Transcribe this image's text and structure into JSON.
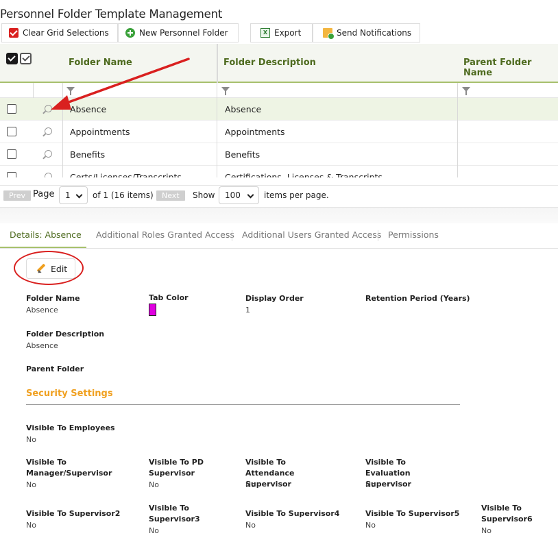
{
  "page": {
    "title": "Personnel Folder Template Management"
  },
  "toolbar": {
    "clear_label": "Clear Grid Selections",
    "new_label": "New Personnel Folder",
    "export_label": "Export",
    "notify_label": "Send Notifications",
    "export_icon_text": "X"
  },
  "grid": {
    "headers": [
      "Folder Name",
      "Folder Description",
      "Parent Folder Name"
    ],
    "rows": [
      {
        "name": "Absence",
        "description": "Absence",
        "parent": ""
      },
      {
        "name": "Appointments",
        "description": "Appointments",
        "parent": ""
      },
      {
        "name": "Benefits",
        "description": "Benefits",
        "parent": ""
      },
      {
        "name": "Certs/Licenses/Transcripts",
        "description": "Certifications, Licenses & Transcripts",
        "parent": ""
      }
    ]
  },
  "pager": {
    "prev": "Prev",
    "page_label": "Page",
    "page_value": "1",
    "of_text": "of 1 (16 items)",
    "next": "Next",
    "show_label": "Show",
    "per_page_value": "100",
    "per_page_suffix": "items per page."
  },
  "tabs": [
    {
      "label": "Details: Absence",
      "active": true
    },
    {
      "label": "Additional Roles Granted Access",
      "active": false
    },
    {
      "label": "Additional Users Granted Access",
      "active": false
    },
    {
      "label": "Permissions",
      "active": false
    }
  ],
  "details": {
    "edit_label": "Edit",
    "folder_name_label": "Folder Name",
    "folder_name_value": "Absence",
    "tab_color_label": "Tab Color",
    "tab_color": "#e000e0",
    "display_order_label": "Display Order",
    "display_order_value": "1",
    "retention_label": "Retention Period (Years)",
    "folder_desc_label": "Folder Description",
    "folder_desc_value": "Absence",
    "parent_folder_label": "Parent Folder",
    "security_title": "Security Settings",
    "visible_employees_label": "Visible To Employees",
    "visible_employees_value": "No",
    "vis_manager_label": "Visible To Manager/Supervisor",
    "vis_manager_value": "No",
    "vis_pd_label": "Visible To PD Supervisor",
    "vis_pd_value": "No",
    "vis_att_label": "Visible To Attendance Supervisor",
    "vis_att_value": "No",
    "vis_eval_label": "Visible To Evaluation Supervisor",
    "vis_eval_value": "No",
    "vis_s2_label": "Visible To Supervisor2",
    "vis_s2_value": "No",
    "vis_s3_label": "Visible To Supervisor3",
    "vis_s3_value": "No",
    "vis_s4_label": "Visible To Supervisor4",
    "vis_s4_value": "No",
    "vis_s5_label": "Visible To Supervisor5",
    "vis_s5_value": "No",
    "vis_s6_label": "Visible To Supervisor6",
    "vis_s6_value": "No"
  },
  "colors": {
    "accent": "#4d6a1e",
    "accent_line": "#a7c06c",
    "orange": "#f0a020",
    "annotation": "#d9201f"
  }
}
